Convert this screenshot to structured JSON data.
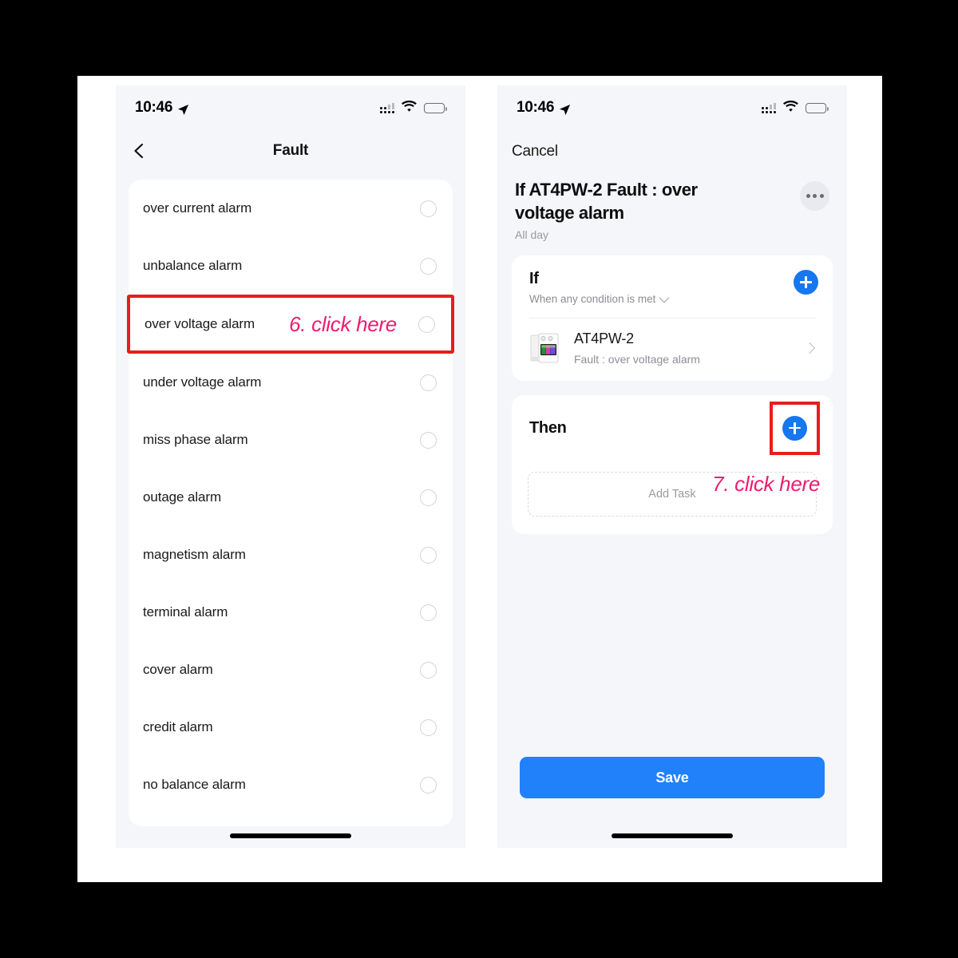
{
  "left_phone": {
    "status_bar": {
      "time": "10:46",
      "location_icon": "location-arrow-icon",
      "signal_icon": "signal-dots-icon",
      "wifi_icon": "wifi-icon",
      "battery_icon": "battery-icon"
    },
    "nav": {
      "back_icon": "chevron-left-icon",
      "title": "Fault"
    },
    "list": [
      {
        "label": "over current alarm",
        "selected": false,
        "highlighted": false
      },
      {
        "label": "unbalance alarm",
        "selected": false,
        "highlighted": false
      },
      {
        "label": "over voltage alarm",
        "selected": false,
        "highlighted": true,
        "annotation": "6. click here"
      },
      {
        "label": "under voltage alarm",
        "selected": false,
        "highlighted": false
      },
      {
        "label": "miss phase alarm",
        "selected": false,
        "highlighted": false
      },
      {
        "label": "outage alarm",
        "selected": false,
        "highlighted": false
      },
      {
        "label": "magnetism alarm",
        "selected": false,
        "highlighted": false
      },
      {
        "label": "terminal alarm",
        "selected": false,
        "highlighted": false
      },
      {
        "label": "cover alarm",
        "selected": false,
        "highlighted": false
      },
      {
        "label": "credit alarm",
        "selected": false,
        "highlighted": false
      },
      {
        "label": "no balance alarm",
        "selected": false,
        "highlighted": false
      }
    ]
  },
  "right_phone": {
    "status_bar": {
      "time": "10:46",
      "location_icon": "location-arrow-icon",
      "signal_icon": "signal-dots-icon",
      "wifi_icon": "wifi-icon",
      "battery_icon": "battery-icon"
    },
    "cancel_label": "Cancel",
    "title": "If AT4PW-2 Fault : over voltage alarm",
    "subtitle": "All day",
    "more_icon": "ellipsis-icon",
    "if_card": {
      "heading": "If",
      "condition_mode": "When any condition is met",
      "dropdown_icon": "chevron-down-icon",
      "add_icon": "plus-circle-icon",
      "device": {
        "icon": "din-rail-meter-icon",
        "name": "AT4PW-2",
        "description": "Fault : over voltage alarm",
        "chevron_icon": "chevron-right-icon"
      }
    },
    "then_card": {
      "heading": "Then",
      "add_icon": "plus-circle-icon",
      "annotation": "7. click here",
      "add_task_label": "Add Task"
    },
    "save_label": "Save"
  },
  "annotation_colors": {
    "box": "#e81d1d",
    "text": "#ec1c70"
  }
}
